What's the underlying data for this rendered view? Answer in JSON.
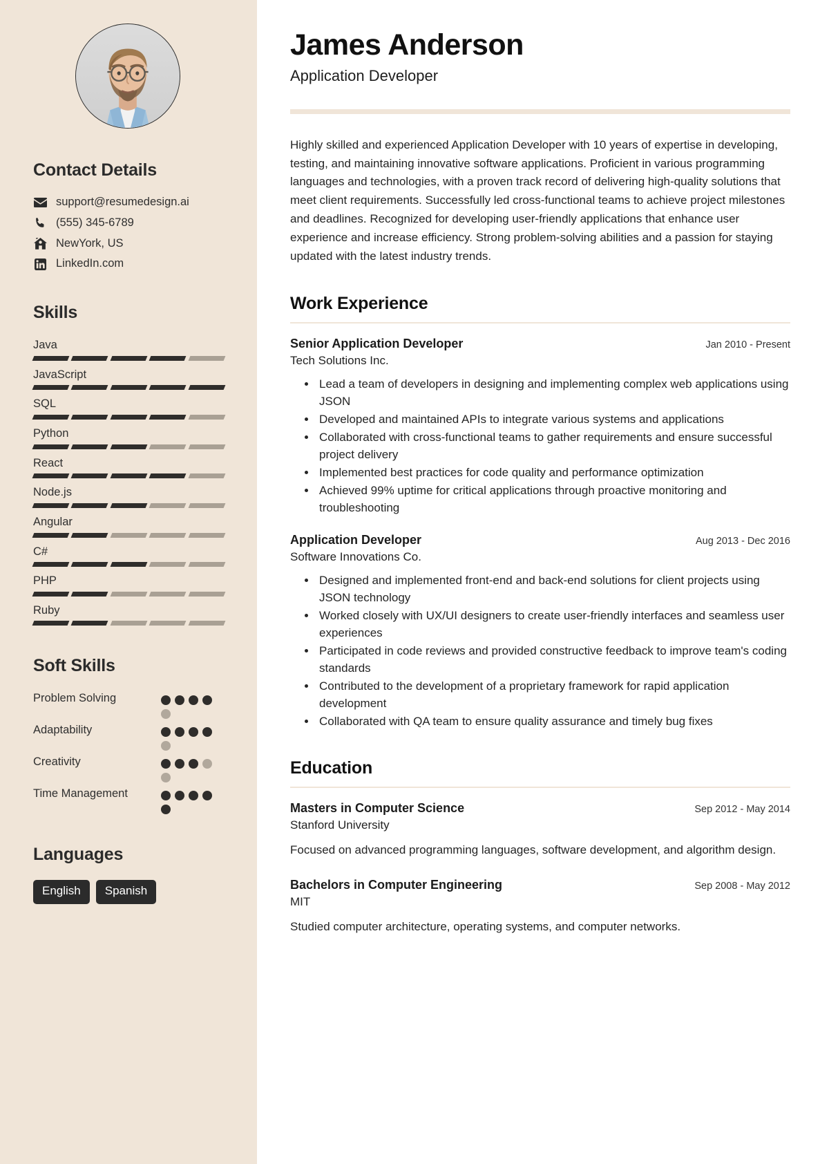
{
  "sidebar": {
    "avatar_alt": "profile-photo",
    "contact": {
      "heading": "Contact Details",
      "items": [
        {
          "icon": "envelope-icon",
          "value": "support@resumedesign.ai"
        },
        {
          "icon": "phone-icon",
          "value": "(555) 345-6789"
        },
        {
          "icon": "home-icon",
          "value": "NewYork, US"
        },
        {
          "icon": "linkedin-icon",
          "value": "LinkedIn.com"
        }
      ]
    },
    "skills": {
      "heading": "Skills",
      "max": 5,
      "items": [
        {
          "name": "Java",
          "level": 4
        },
        {
          "name": "JavaScript",
          "level": 5
        },
        {
          "name": "SQL",
          "level": 4
        },
        {
          "name": "Python",
          "level": 3
        },
        {
          "name": "React",
          "level": 4
        },
        {
          "name": "Node.js",
          "level": 3
        },
        {
          "name": "Angular",
          "level": 2
        },
        {
          "name": "C#",
          "level": 3
        },
        {
          "name": "PHP",
          "level": 2
        },
        {
          "name": "Ruby",
          "level": 2
        }
      ]
    },
    "soft_skills": {
      "heading": "Soft Skills",
      "max": 5,
      "items": [
        {
          "name": "Problem Solving",
          "level": 4
        },
        {
          "name": "Adaptability",
          "level": 4
        },
        {
          "name": "Creativity",
          "level": 3
        },
        {
          "name": "Time Management",
          "level": 5
        }
      ]
    },
    "languages": {
      "heading": "Languages",
      "items": [
        "English",
        "Spanish"
      ]
    }
  },
  "main": {
    "name": "James Anderson",
    "role": "Application Developer",
    "summary": "Highly skilled and experienced Application Developer with 10 years of expertise in developing, testing, and maintaining innovative software applications. Proficient in various programming languages and technologies, with a proven track record of delivering high-quality solutions that meet client requirements. Successfully led cross-functional teams to achieve project milestones and deadlines. Recognized for developing user-friendly applications that enhance user experience and increase efficiency. Strong problem-solving abilities and a passion for staying updated with the latest industry trends.",
    "work": {
      "heading": "Work Experience",
      "items": [
        {
          "title": "Senior Application Developer",
          "company": "Tech Solutions Inc.",
          "date": "Jan 2010 - Present",
          "bullets": [
            "Lead a team of developers in designing and implementing complex web applications using JSON",
            "Developed and maintained APIs to integrate various systems and applications",
            "Collaborated with cross-functional teams to gather requirements and ensure successful project delivery",
            "Implemented best practices for code quality and performance optimization",
            "Achieved 99% uptime for critical applications through proactive monitoring and troubleshooting"
          ]
        },
        {
          "title": "Application Developer",
          "company": "Software Innovations Co.",
          "date": "Aug 2013 - Dec 2016",
          "bullets": [
            "Designed and implemented front-end and back-end solutions for client projects using JSON technology",
            "Worked closely with UX/UI designers to create user-friendly interfaces and seamless user experiences",
            "Participated in code reviews and provided constructive feedback to improve team's coding standards",
            "Contributed to the development of a proprietary framework for rapid application development",
            "Collaborated with QA team to ensure quality assurance and timely bug fixes"
          ]
        }
      ]
    },
    "education": {
      "heading": "Education",
      "items": [
        {
          "title": "Masters in Computer Science",
          "school": "Stanford University",
          "date": "Sep 2012 - May 2014",
          "description": "Focused on advanced programming languages, software development, and algorithm design."
        },
        {
          "title": "Bachelors in Computer Engineering",
          "school": "MIT",
          "date": "Sep 2008 - May 2012",
          "description": "Studied computer architecture, operating systems, and computer networks."
        }
      ]
    }
  },
  "colors": {
    "sidebar_bg": "#f0e5d8",
    "ink": "#2b2b2b",
    "bar_on": "#2f2d2b",
    "bar_off": "#a9a094",
    "chip_bg": "#2b2b2b"
  }
}
